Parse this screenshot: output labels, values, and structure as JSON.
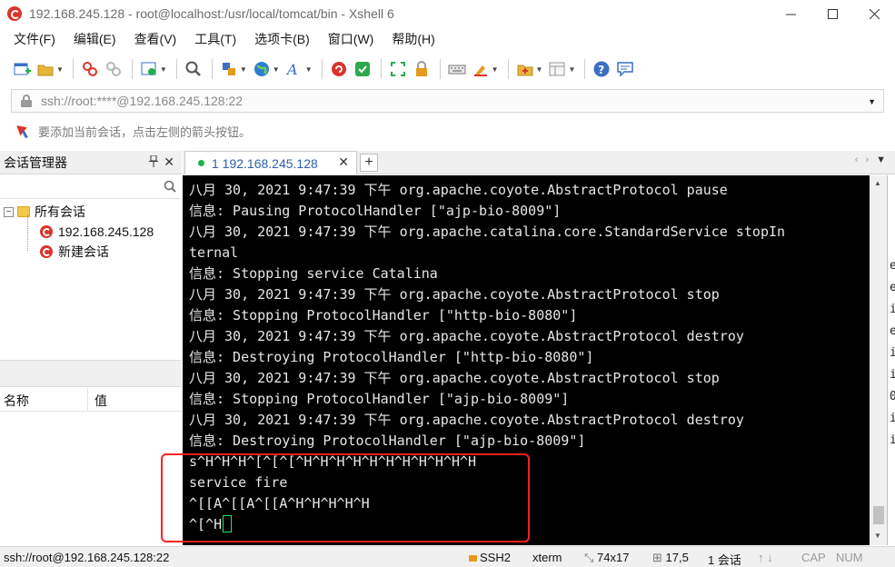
{
  "window": {
    "title": "192.168.245.128 - root@localhost:/usr/local/tomcat/bin - Xshell 6"
  },
  "menu": {
    "items": [
      "文件(F)",
      "编辑(E)",
      "查看(V)",
      "工具(T)",
      "选项卡(B)",
      "窗口(W)",
      "帮助(H)"
    ]
  },
  "toolbar": {
    "icons": [
      "new-session-icon",
      "open-folder-icon",
      "reconnect-icon",
      "disconnect-icon",
      "properties-icon",
      "find-icon",
      "transfer-icon",
      "globe-icon",
      "font-icon",
      "xshell-icon",
      "xftp-icon",
      "fullscreen-icon",
      "lock-icon",
      "keyboard-icon",
      "highlight-icon",
      "add-session-icon",
      "layout-icon",
      "help-icon",
      "chat-icon"
    ]
  },
  "address": {
    "value": "ssh://root:****@192.168.245.128:22"
  },
  "hint": {
    "text": "要添加当前会话，点击左侧的箭头按钮。"
  },
  "session_manager": {
    "title": "会话管理器",
    "pin": "ᵖ",
    "close": "✕",
    "tree": {
      "root_label": "所有会话",
      "items": [
        "192.168.245.128",
        "新建会话"
      ]
    },
    "properties": {
      "col_name": "名称",
      "col_value": "值"
    }
  },
  "tabs": {
    "active_label": "1 192.168.245.128",
    "close": "✕",
    "add": "+"
  },
  "terminal": {
    "lines": [
      "八月 30, 2021 9:47:39 下午 org.apache.coyote.AbstractProtocol pause",
      "信息: Pausing ProtocolHandler [\"ajp-bio-8009\"]",
      "八月 30, 2021 9:47:39 下午 org.apache.catalina.core.StandardService stopIn",
      "ternal",
      "信息: Stopping service Catalina",
      "八月 30, 2021 9:47:39 下午 org.apache.coyote.AbstractProtocol stop",
      "信息: Stopping ProtocolHandler [\"http-bio-8080\"]",
      "八月 30, 2021 9:47:39 下午 org.apache.coyote.AbstractProtocol destroy",
      "信息: Destroying ProtocolHandler [\"http-bio-8080\"]",
      "八月 30, 2021 9:47:39 下午 org.apache.coyote.AbstractProtocol stop",
      "信息: Stopping ProtocolHandler [\"ajp-bio-8009\"]",
      "八月 30, 2021 9:47:39 下午 org.apache.coyote.AbstractProtocol destroy",
      "信息: Destroying ProtocolHandler [\"ajp-bio-8009\"]",
      "s^H^H^H^[^[^[^H^H^H^H^H^H^H^H^H^H^H",
      "service fire",
      "^[[A^[[A^[[A^H^H^H^H^H",
      "^[^H"
    ],
    "highlight_color": "#ff2020",
    "cursor_color": "#27e06b"
  },
  "right_strip": {
    "chars": [
      "e",
      "e",
      "i",
      "e",
      "i",
      "i",
      "0",
      "i",
      "i"
    ]
  },
  "status": {
    "connection": "ssh://root@192.168.245.128:22",
    "protocol": "SSH2",
    "terminal_type": "xterm",
    "size": "74x17",
    "cursor_pos": "17,5",
    "sessions": "1 会话",
    "caps": "CAP",
    "num": "NUM"
  }
}
